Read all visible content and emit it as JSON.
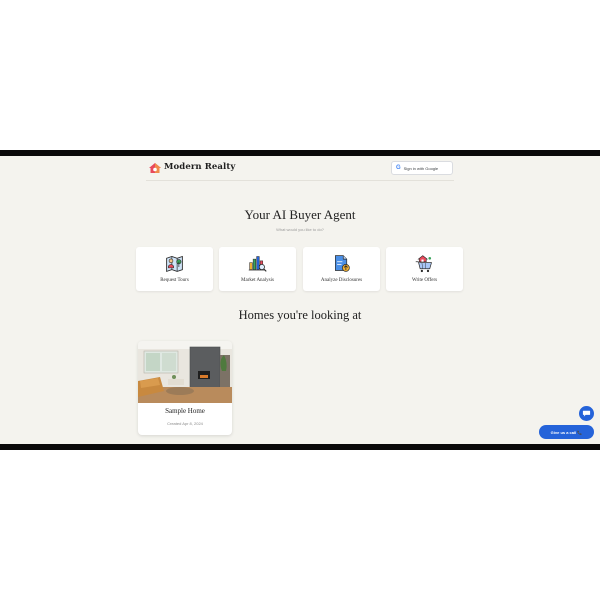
{
  "header": {
    "brand": "Modern Realty",
    "google_button_label": "Sign in with Google"
  },
  "hero": {
    "title": "Your AI Buyer Agent",
    "subtitle": "What would you like to do?"
  },
  "actions": [
    {
      "label": "Request Tours",
      "icon": "map-tour-icon"
    },
    {
      "label": "Market Analysis",
      "icon": "bar-chart-magnifier-icon"
    },
    {
      "label": "Analyze Disclosures",
      "icon": "document-upload-icon"
    },
    {
      "label": "Write Offers",
      "icon": "shopping-cart-house-icon"
    }
  ],
  "homes_section": {
    "title": "Homes you're looking at",
    "homes": [
      {
        "name": "Sample Home",
        "created": "Created Apr 8, 2024",
        "photo": "living-room-photo"
      }
    ]
  },
  "widgets": {
    "chat_icon": "chat-bubble-icon",
    "call_label": "Give us a call 📞"
  },
  "colors": {
    "page_background": "#f4f3ee",
    "accent": "#2563d9",
    "frame": "#0a0a0a"
  }
}
